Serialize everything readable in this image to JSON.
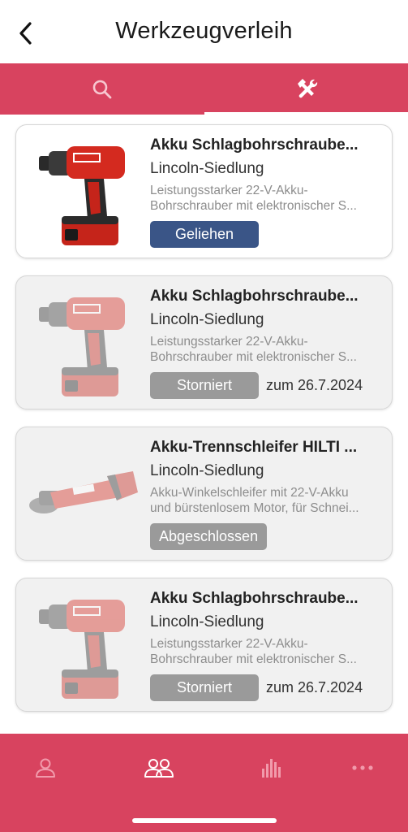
{
  "header": {
    "title": "Werkzeugverleih"
  },
  "tabs": [
    {
      "icon": "search-icon",
      "active": false
    },
    {
      "icon": "tools-icon",
      "active": true
    }
  ],
  "items": [
    {
      "name": "Akku Schlagbohrschraube...",
      "location": "Lincoln-Siedlung",
      "desc_line1": "Leistungsstarker 22-V-Akku-",
      "desc_line2": "Bohrschrauber mit elektronischer S...",
      "status": "Geliehen",
      "date": "",
      "image": "drill-image"
    },
    {
      "name": "Akku Schlagbohrschraube...",
      "location": "Lincoln-Siedlung",
      "desc_line1": "Leistungsstarker 22-V-Akku-",
      "desc_line2": "Bohrschrauber mit elektronischer S...",
      "status": "Storniert",
      "date": "zum 26.7.2024",
      "image": "drill-image"
    },
    {
      "name": "Akku-Trennschleifer HILTI ...",
      "location": "Lincoln-Siedlung",
      "desc_line1": "Akku-Winkelschleifer mit 22-V-Akku",
      "desc_line2": "und bürstenlosem Motor, für Schnei...",
      "status": "Abgeschlossen",
      "date": "",
      "image": "angle-grinder-image"
    },
    {
      "name": "Akku Schlagbohrschraube...",
      "location": "Lincoln-Siedlung",
      "desc_line1": "Leistungsstarker 22-V-Akku-",
      "desc_line2": "Bohrschrauber mit elektronischer S...",
      "status": "Storniert",
      "date": "zum 26.7.2024",
      "image": "drill-image"
    }
  ],
  "bottom_nav": [
    {
      "icon": "profile-icon",
      "active": false
    },
    {
      "icon": "community-icon",
      "active": true
    },
    {
      "icon": "stats-icon",
      "active": false
    },
    {
      "icon": "more-icon",
      "active": false
    }
  ],
  "colors": {
    "accent": "#d8435f",
    "status_blue": "#3a5587",
    "status_gray": "#9a9a9a"
  }
}
